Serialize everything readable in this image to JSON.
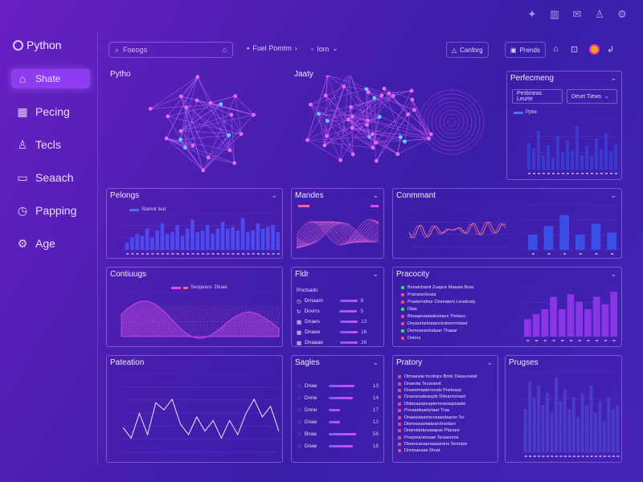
{
  "colors": {
    "accent": "#8d3cf0",
    "bar": "#4d4bf0",
    "magenta": "#d84cf0",
    "pink": "#ff5fa0",
    "orange": "#ff9a4a",
    "cyan": "#5bd1ff"
  },
  "top_icons": [
    "puzzle-icon",
    "chart-icon",
    "mail-icon",
    "user-icon",
    "gear-icon"
  ],
  "brand": {
    "title": "Python"
  },
  "sidebar": {
    "items": [
      {
        "label": "Shate",
        "icon": "home-icon",
        "active": true
      },
      {
        "label": "Pecing",
        "icon": "grid-icon"
      },
      {
        "label": "Tecls",
        "icon": "person-icon"
      },
      {
        "label": "Seaach",
        "icon": "folder-icon"
      },
      {
        "label": "Papping",
        "icon": "clock-icon"
      },
      {
        "label": "Age",
        "icon": "gear-icon"
      }
    ]
  },
  "toolbar": {
    "search_value": "Foeogs",
    "dropdown1": "Fuel Pomtm",
    "dropdown2": "Iom",
    "btn1": "Canforg",
    "btn2": "Prends"
  },
  "panels": {
    "network1": {
      "title": "Pytho"
    },
    "network2": {
      "title": "Jaaty"
    },
    "perfermg": {
      "title": "Perfecmeng",
      "select1": "Pesbneas Leurte",
      "select2": "Deurt Tiews",
      "legend": "Ppbe",
      "values": [
        0.55,
        0.45,
        0.8,
        0.3,
        0.5,
        0.25,
        0.7,
        0.35,
        0.6,
        0.4,
        0.9,
        0.3,
        0.5,
        0.28,
        0.65,
        0.42,
        0.75,
        0.38,
        0.52
      ]
    },
    "pelongs": {
      "title": "Pelongs",
      "legend": "Slamor leal",
      "values": [
        0.2,
        0.35,
        0.45,
        0.4,
        0.6,
        0.35,
        0.55,
        0.75,
        0.45,
        0.5,
        0.7,
        0.4,
        0.6,
        0.85,
        0.5,
        0.55,
        0.7,
        0.45,
        0.6,
        0.8,
        0.6,
        0.65,
        0.55,
        0.9,
        0.5,
        0.55,
        0.75,
        0.6,
        0.65,
        0.7,
        0.5
      ]
    },
    "mandes": {
      "title": "Mandes"
    },
    "comment": {
      "title": "Conmmant",
      "values": [
        0.35,
        0.55,
        0.8,
        0.35,
        0.6,
        0.4
      ]
    },
    "continugs": {
      "title": "Contiuugs",
      "legend": "Seopeacs",
      "legend2": "Dtuae"
    },
    "fildr": {
      "title": "Fldr",
      "header": "Pnclsads",
      "rows": [
        {
          "label": "Drnaam",
          "val": "8"
        },
        {
          "label": "Dovrrs",
          "val": "5"
        },
        {
          "label": "Dnaes",
          "val": "13"
        },
        {
          "label": "Dnaee",
          "val": "16"
        },
        {
          "label": "Dnaaae",
          "val": "26"
        }
      ]
    },
    "proocity": {
      "title": "Pracocity",
      "items": [
        "Bonatchamt Zuapce Maaata Braa",
        "Pranaracleusa",
        "Prsaterndnur Ctreeatent Leratinaty",
        "Dtaa",
        "Bloaapsaatadesnacs Thotacs",
        "Doyaorlartriatanciratrenrnotast",
        "Demeansnlodaao Thaaar",
        "Dotors"
      ],
      "values": [
        0.35,
        0.45,
        0.55,
        0.8,
        0.55,
        0.85,
        0.7,
        0.55,
        0.8,
        0.65,
        0.9
      ]
    },
    "pateation": {
      "title": "Pateation"
    },
    "saggles": {
      "title": "Sagles",
      "rows": [
        {
          "label": "Dnae",
          "val": "13",
          "fill": 0.9
        },
        {
          "label": "Dnne",
          "val": "14",
          "fill": 0.85
        },
        {
          "label": "Dnne",
          "val": "17",
          "fill": 0.4
        },
        {
          "label": "Dnae",
          "val": "12",
          "fill": 0.4
        },
        {
          "label": "Bnae",
          "val": "56",
          "fill": 0.95
        },
        {
          "label": "Dnae",
          "val": "18",
          "fill": 0.85
        }
      ]
    },
    "pratory": {
      "title": "Pratory",
      "items": [
        "Dtmaavtar Incdrqre Bmtc Dasaceatat",
        "Dnaesta Tecaraest",
        "Dnaeemaaterneats Pnetsacp",
        "Dnaearsaleaopitr Ddeannonast",
        "Dtdasaaopeaplemeaoaapsaate",
        "Pnvaatdaadsrtaar Traa",
        "Dnaeastaarrscceaantaarss Tsr",
        "Dteneasaetaiararotnedaro",
        "Dnamdartpsaaapae Ptarsee",
        "Pnaomaramaae Tsraasrsna",
        "Dteannaoaenaaaarans Tersrase",
        "Dnntsaeaae Dtoat"
      ]
    },
    "prugses": {
      "title": "Prugses",
      "values": [
        0.55,
        0.9,
        0.7,
        0.85,
        0.6,
        0.75,
        0.5,
        0.95,
        0.65,
        0.8,
        0.55,
        0.7,
        0.45,
        0.75,
        0.6,
        0.85,
        0.5,
        0.65,
        0.4,
        0.7,
        0.55,
        0.6
      ]
    }
  }
}
